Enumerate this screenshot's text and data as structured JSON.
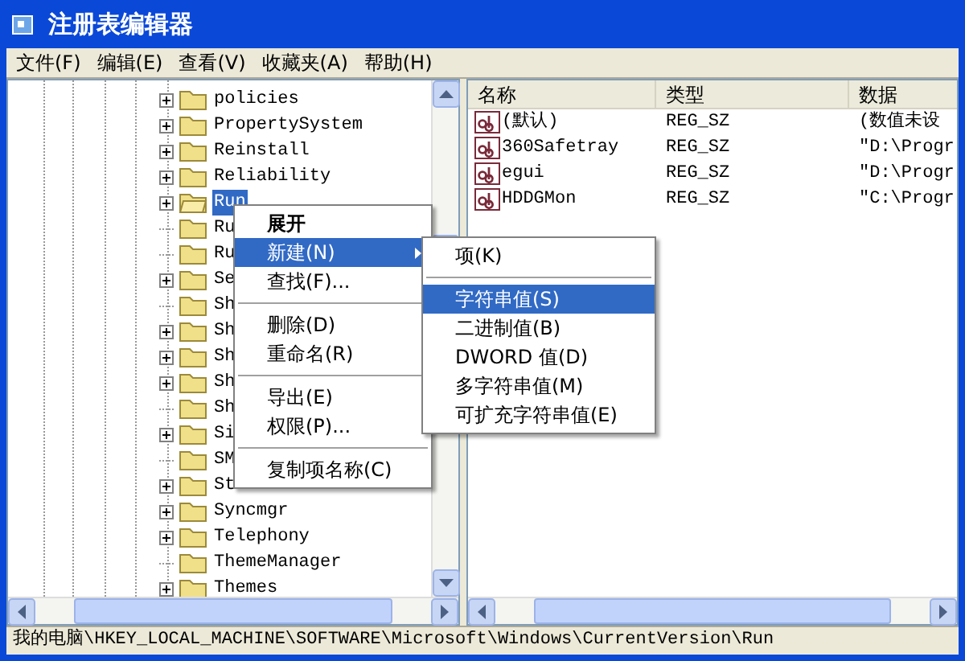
{
  "window": {
    "title": "注册表编辑器"
  },
  "menu_bar": [
    {
      "label": "文件(F)"
    },
    {
      "label": "编辑(E)"
    },
    {
      "label": "查看(V)"
    },
    {
      "label": "收藏夹(A)"
    },
    {
      "label": "帮助(H)"
    }
  ],
  "tree": {
    "items": [
      {
        "label": "policies",
        "expandable": true,
        "selected": false
      },
      {
        "label": "PropertySystem",
        "expandable": true,
        "selected": false
      },
      {
        "label": "Reinstall",
        "expandable": true,
        "selected": false
      },
      {
        "label": "Reliability",
        "expandable": true,
        "selected": false
      },
      {
        "label": "Run",
        "expandable": true,
        "selected": true
      },
      {
        "label": "Ru",
        "expandable": false,
        "selected": false
      },
      {
        "label": "Ru",
        "expandable": false,
        "selected": false
      },
      {
        "label": "Se",
        "expandable": true,
        "selected": false
      },
      {
        "label": "Sh",
        "expandable": false,
        "selected": false
      },
      {
        "label": "Sh",
        "expandable": true,
        "selected": false
      },
      {
        "label": "Sh",
        "expandable": true,
        "selected": false
      },
      {
        "label": "Sh",
        "expandable": true,
        "selected": false
      },
      {
        "label": "Sh",
        "expandable": false,
        "selected": false
      },
      {
        "label": "Si",
        "expandable": true,
        "selected": false
      },
      {
        "label": "SM",
        "expandable": false,
        "selected": false
      },
      {
        "label": "St",
        "expandable": true,
        "selected": false
      },
      {
        "label": "Syncmgr",
        "expandable": true,
        "selected": false
      },
      {
        "label": "Telephony",
        "expandable": true,
        "selected": false
      },
      {
        "label": "ThemeManager",
        "expandable": false,
        "selected": false
      },
      {
        "label": "Themes",
        "expandable": true,
        "selected": false
      }
    ]
  },
  "values_table": {
    "columns": [
      "名称",
      "类型",
      "数据"
    ],
    "rows": [
      {
        "name": "(默认)",
        "type": "REG_SZ",
        "data": "(数值未设"
      },
      {
        "name": "360Safetray",
        "type": "REG_SZ",
        "data": "\"D:\\Progr"
      },
      {
        "name": "egui",
        "type": "REG_SZ",
        "data": "\"D:\\Progr"
      },
      {
        "name": "HDDGMon",
        "type": "REG_SZ",
        "data": "\"C:\\Progr"
      }
    ]
  },
  "context_menu": {
    "items": [
      {
        "kind": "item",
        "label": "展开",
        "bold": true,
        "selected": false,
        "submenu": false
      },
      {
        "kind": "item",
        "label": "新建(N)",
        "bold": false,
        "selected": true,
        "submenu": true
      },
      {
        "kind": "item",
        "label": "查找(F)...",
        "bold": false,
        "selected": false,
        "submenu": false
      },
      {
        "kind": "separator"
      },
      {
        "kind": "item",
        "label": "删除(D)",
        "bold": false,
        "selected": false,
        "submenu": false
      },
      {
        "kind": "item",
        "label": "重命名(R)",
        "bold": false,
        "selected": false,
        "submenu": false
      },
      {
        "kind": "separator"
      },
      {
        "kind": "item",
        "label": "导出(E)",
        "bold": false,
        "selected": false,
        "submenu": false
      },
      {
        "kind": "item",
        "label": "权限(P)...",
        "bold": false,
        "selected": false,
        "submenu": false
      },
      {
        "kind": "separator"
      },
      {
        "kind": "item",
        "label": "复制项名称(C)",
        "bold": false,
        "selected": false,
        "submenu": false
      }
    ]
  },
  "submenu": {
    "items": [
      {
        "kind": "item",
        "label": "项(K)",
        "selected": false
      },
      {
        "kind": "separator"
      },
      {
        "kind": "item",
        "label": "字符串值(S)",
        "selected": true
      },
      {
        "kind": "item",
        "label": "二进制值(B)",
        "selected": false
      },
      {
        "kind": "item",
        "label": "DWORD 值(D)",
        "selected": false
      },
      {
        "kind": "item",
        "label": "多字符串值(M)",
        "selected": false
      },
      {
        "kind": "item",
        "label": "可扩充字符串值(E)",
        "selected": false
      }
    ]
  },
  "status_bar": "我的电脑\\HKEY_LOCAL_MACHINE\\SOFTWARE\\Microsoft\\Windows\\CurrentVersion\\Run"
}
